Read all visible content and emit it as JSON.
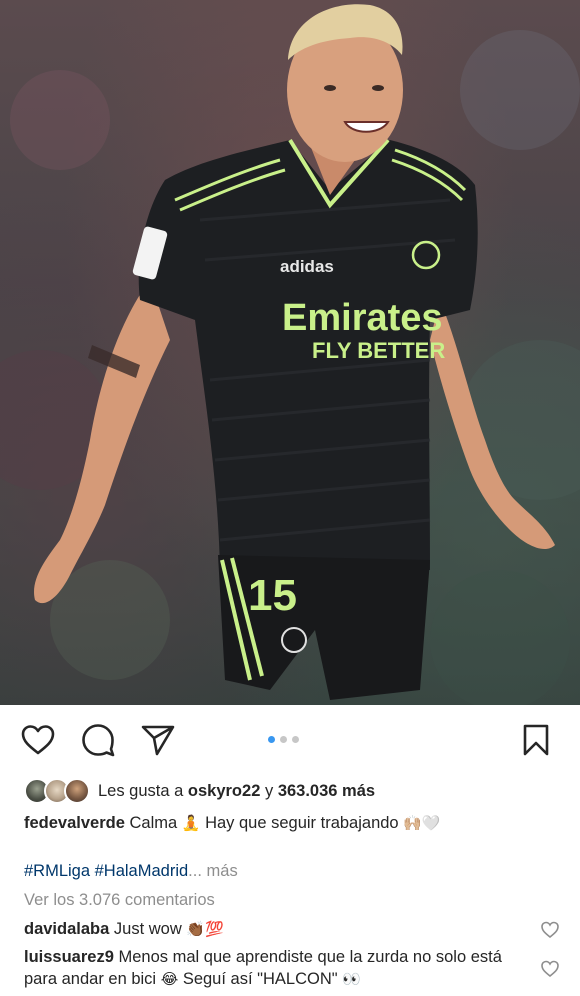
{
  "post": {
    "image": {
      "jersey_sponsor_line1": "Emirates",
      "jersey_sponsor_line2": "FLY BETTER",
      "jersey_brand": "adidas",
      "shorts_number": "15",
      "colors": {
        "jersey": "#1d1f22",
        "trim": "#c9f08a",
        "skin": "#d9a17f",
        "hair": "#e2cfa0"
      }
    },
    "carousel": {
      "count": 3,
      "active_index": 0
    },
    "likes": {
      "prefix": "Les gusta a",
      "user": "oskyro22",
      "middle": "y",
      "count": "363.036 más"
    },
    "caption": {
      "username": "fedevalverde",
      "text": "Calma",
      "emoji1": "🧘",
      "text2": "Hay que seguir trabajando",
      "emoji2": "🙌🏼🤍"
    },
    "tags": {
      "text": "#RMLiga #HalaMadrid",
      "ellipsis": "...",
      "more": "más"
    },
    "view_comments": "Ver los 3.076 comentarios",
    "comments": [
      {
        "username": "davidalaba",
        "text": "Just wow",
        "emoji": "👏🏾💯"
      },
      {
        "username": "luissuarez9",
        "text": "Menos mal que aprendiste que la zurda no solo está para andar en bici",
        "emoji": "😂",
        "text2": "Seguí así \"HALCON\"",
        "emoji2": "👀"
      }
    ]
  },
  "icons": [
    "heart-icon",
    "comment-icon",
    "share-icon",
    "bookmark-icon"
  ],
  "accent_color": "#3897f0"
}
